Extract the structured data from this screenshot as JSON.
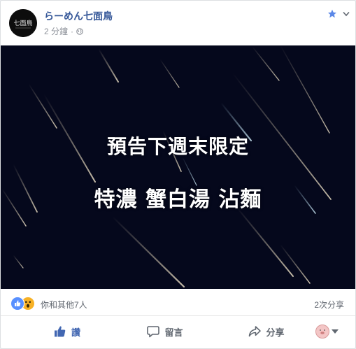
{
  "post": {
    "page_name": "らーめん七面鳥",
    "timestamp": "2 分鐘",
    "separator": "·",
    "audience_icon": "globe-icon",
    "favorite_icon": "star-icon",
    "options_icon": "chevron-down-icon",
    "avatar_text": "七面鳥"
  },
  "media": {
    "line1": "預告下週末限定",
    "line2": "特濃 蟹白湯 沾麵",
    "background": "#05081c"
  },
  "engagement": {
    "reactions_text": "你和其他7人",
    "shares_text": "2次分享",
    "reaction_icons": [
      "like-reaction-icon",
      "wow-reaction-icon"
    ]
  },
  "actions": {
    "like": "讚",
    "comment": "留言",
    "share": "分享",
    "audience_icon": "pig-avatar-icon"
  },
  "colors": {
    "link": "#365899",
    "liked": "#4267b2",
    "muted": "#90949c"
  }
}
